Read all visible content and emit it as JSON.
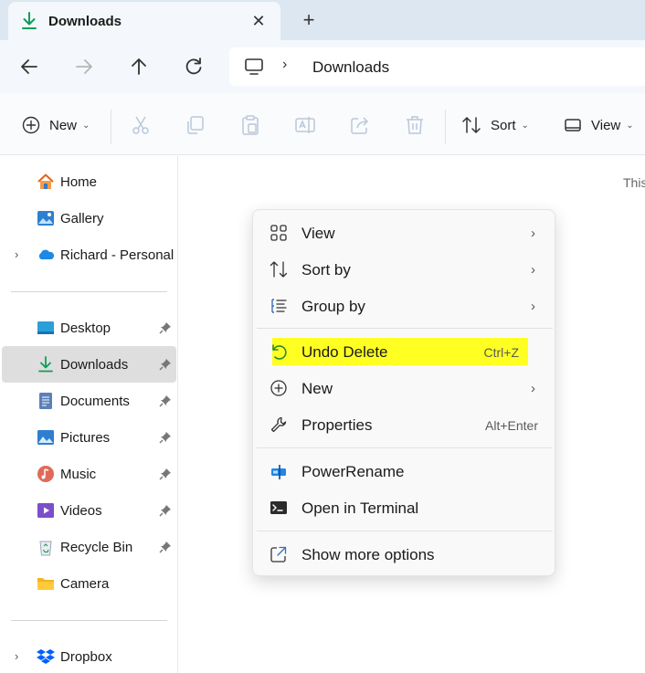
{
  "tab": {
    "title": "Downloads",
    "close_glyph": "✕",
    "new_tab_glyph": "+"
  },
  "address": {
    "separator": "›",
    "path": "Downloads"
  },
  "toolbar": {
    "new_label": "New",
    "sort_label": "Sort",
    "view_label": "View",
    "chevron": "⌄"
  },
  "sidebar": {
    "items": [
      {
        "label": "Home",
        "icon": "home-icon"
      },
      {
        "label": "Gallery",
        "icon": "gallery-icon"
      },
      {
        "label": "Richard - Personal",
        "icon": "onedrive-icon"
      },
      {
        "label": "Desktop",
        "icon": "desktop-icon"
      },
      {
        "label": "Downloads",
        "icon": "download-icon"
      },
      {
        "label": "Documents",
        "icon": "documents-icon"
      },
      {
        "label": "Pictures",
        "icon": "pictures-icon"
      },
      {
        "label": "Music",
        "icon": "music-icon"
      },
      {
        "label": "Videos",
        "icon": "videos-icon"
      },
      {
        "label": "Recycle Bin",
        "icon": "recycle-bin-icon"
      },
      {
        "label": "Camera",
        "icon": "folder-icon"
      },
      {
        "label": "Dropbox",
        "icon": "dropbox-icon"
      }
    ],
    "expander": "›"
  },
  "content": {
    "empty_text": "This"
  },
  "context_menu": {
    "items": [
      {
        "label": "View",
        "icon": "grid-icon",
        "submenu": "›"
      },
      {
        "label": "Sort by",
        "icon": "sort-icon",
        "submenu": "›"
      },
      {
        "label": "Group by",
        "icon": "group-icon",
        "submenu": "›"
      },
      {
        "label": "Undo Delete",
        "icon": "undo-icon",
        "accelerator": "Ctrl+Z"
      },
      {
        "label": "New",
        "icon": "plus-circle-icon",
        "submenu": "›"
      },
      {
        "label": "Properties",
        "icon": "wrench-icon",
        "accelerator": "Alt+Enter"
      },
      {
        "label": "PowerRename",
        "icon": "powerrename-icon"
      },
      {
        "label": "Open in Terminal",
        "icon": "terminal-icon"
      },
      {
        "label": "Show more options",
        "icon": "share-icon"
      }
    ]
  },
  "colors": {
    "accent": "#0067c0",
    "download_green": "#0f9d58",
    "highlight": "#ffff22",
    "tab_bar": "#dde7f1"
  }
}
